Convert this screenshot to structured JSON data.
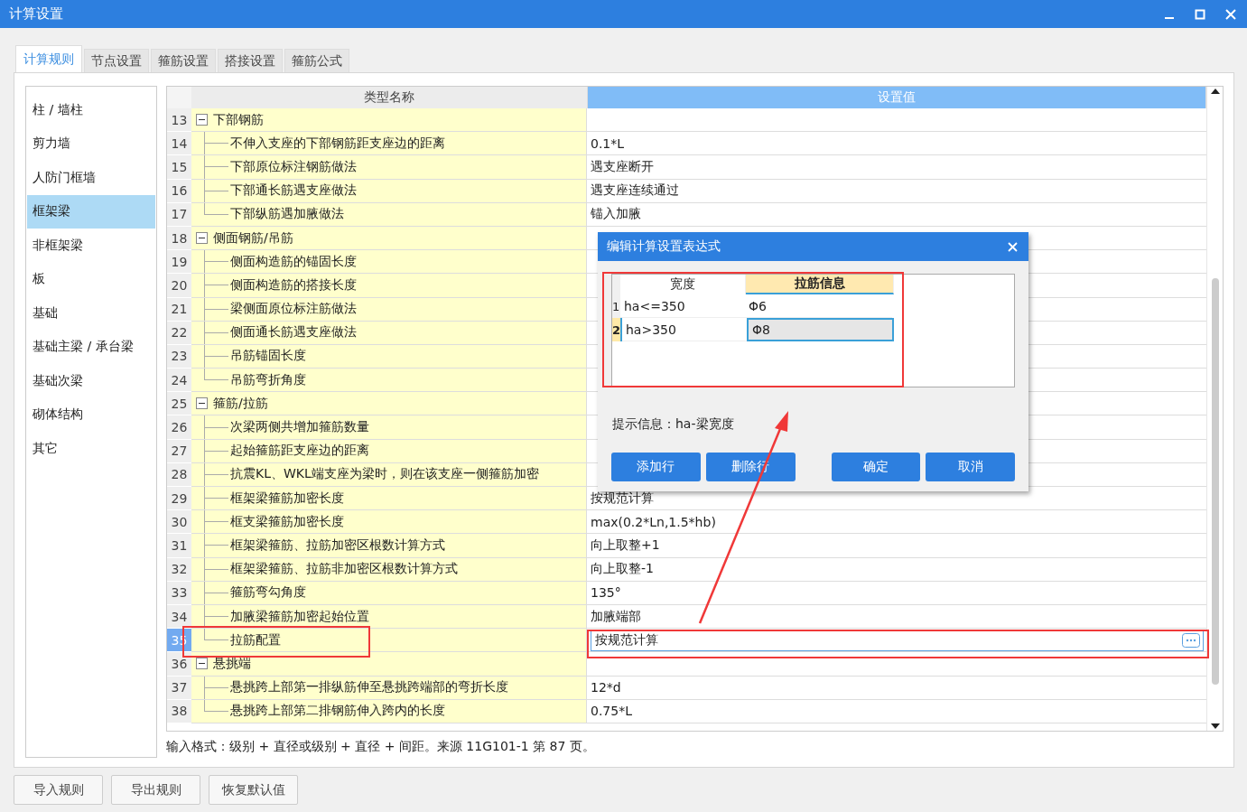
{
  "window": {
    "title": "计算设置"
  },
  "tabs": [
    {
      "label": "计算规则",
      "selected": true
    },
    {
      "label": "节点设置",
      "selected": false
    },
    {
      "label": "箍筋设置",
      "selected": false
    },
    {
      "label": "搭接设置",
      "selected": false
    },
    {
      "label": "箍筋公式",
      "selected": false
    }
  ],
  "categories": [
    {
      "label": "柱 / 墙柱",
      "selected": false
    },
    {
      "label": "剪力墙",
      "selected": false
    },
    {
      "label": "人防门框墙",
      "selected": false
    },
    {
      "label": "框架梁",
      "selected": true
    },
    {
      "label": "非框架梁",
      "selected": false
    },
    {
      "label": "板",
      "selected": false
    },
    {
      "label": "基础",
      "selected": false
    },
    {
      "label": "基础主梁 / 承台梁",
      "selected": false
    },
    {
      "label": "基础次梁",
      "selected": false
    },
    {
      "label": "砌体结构",
      "selected": false
    },
    {
      "label": "其它",
      "selected": false
    }
  ],
  "table": {
    "columns": [
      {
        "label": "类型名称",
        "selected": false
      },
      {
        "label": "设置值",
        "selected": true
      }
    ],
    "rows": [
      {
        "number": "13",
        "name": "下部钢筋",
        "selected": false,
        "expanded": true,
        "children": [
          {
            "number": "14",
            "name": "不伸入支座的下部钢筋距支座边的距离",
            "value": "0.1*L",
            "selected": false
          },
          {
            "number": "15",
            "name": "下部原位标注钢筋做法",
            "value": "遇支座断开",
            "selected": false
          },
          {
            "number": "16",
            "name": "下部通长筋遇支座做法",
            "value": "遇支座连续通过",
            "selected": false
          },
          {
            "number": "17",
            "name": "下部纵筋遇加腋做法",
            "value": "锚入加腋",
            "selected": false
          }
        ]
      },
      {
        "number": "18",
        "name": "侧面钢筋/吊筋",
        "selected": false,
        "expanded": true,
        "children": [
          {
            "number": "19",
            "name": "侧面构造筋的锚固长度",
            "selected": false
          },
          {
            "number": "20",
            "name": "侧面构造筋的搭接长度",
            "selected": false
          },
          {
            "number": "21",
            "name": "梁侧面原位标注筋做法",
            "selected": false
          },
          {
            "number": "22",
            "name": "侧面通长筋遇支座做法",
            "selected": false
          },
          {
            "number": "23",
            "name": "吊筋锚固长度",
            "selected": false
          },
          {
            "number": "24",
            "name": "吊筋弯折角度",
            "selected": false
          }
        ]
      },
      {
        "number": "25",
        "name": "箍筋/拉筋",
        "selected": false,
        "expanded": true,
        "children": [
          {
            "number": "26",
            "name": "次梁两侧共增加箍筋数量",
            "selected": false
          },
          {
            "number": "27",
            "name": "起始箍筋距支座边的距离",
            "selected": false
          },
          {
            "number": "28",
            "name": "抗震KL、WKL端支座为梁时，则在该支座一侧箍筋加密",
            "selected": false
          },
          {
            "number": "29",
            "name": "框架梁箍筋加密长度",
            "value": "按规范计算",
            "selected": false
          },
          {
            "number": "30",
            "name": "框支梁箍筋加密长度",
            "value": "max(0.2*Ln,1.5*hb)",
            "selected": false
          },
          {
            "number": "31",
            "name": "框架梁箍筋、拉筋加密区根数计算方式",
            "value": "向上取整+1",
            "selected": false
          },
          {
            "number": "32",
            "name": "框架梁箍筋、拉筋非加密区根数计算方式",
            "value": "向上取整-1",
            "selected": false
          },
          {
            "number": "33",
            "name": "箍筋弯勾角度",
            "value": "135°",
            "selected": false
          },
          {
            "number": "34",
            "name": "加腋梁箍筋加密起始位置",
            "value": "加腋端部",
            "selected": false
          },
          {
            "number": "35",
            "name": "拉筋配置",
            "value": "按规范计算",
            "selected": true
          }
        ]
      },
      {
        "number": "36",
        "name": "悬挑端",
        "selected": false,
        "expanded": true,
        "children": [
          {
            "number": "37",
            "name": "悬挑跨上部第一排纵筋伸至悬挑跨端部的弯折长度",
            "value": "12*d",
            "selected": false
          },
          {
            "number": "38",
            "name": "悬挑跨上部第二排钢筋伸入跨内的长度",
            "value": "0.75*L",
            "selected": false
          }
        ]
      }
    ]
  },
  "hint": "输入格式：级别 + 直径或级别 + 直径 + 间距。来源 11G101-1 第 87 页。",
  "buttons": [
    "导入规则",
    "导出规则",
    "恢复默认值"
  ],
  "dialog": {
    "title": "编辑计算设置表达式",
    "columns": [
      {
        "label": "宽度",
        "selected": false
      },
      {
        "label": "拉筋信息",
        "selected": true
      }
    ],
    "rows": [
      {
        "number": "1",
        "width": "ha<=350",
        "info": "Φ6",
        "selected": false
      },
      {
        "number": "2",
        "width": "ha>350",
        "info": "Φ8",
        "selected": true
      }
    ],
    "hint": "提示信息：ha-梁宽度",
    "buttons": [
      "添加行",
      "删除行",
      "确定",
      "取消"
    ]
  }
}
